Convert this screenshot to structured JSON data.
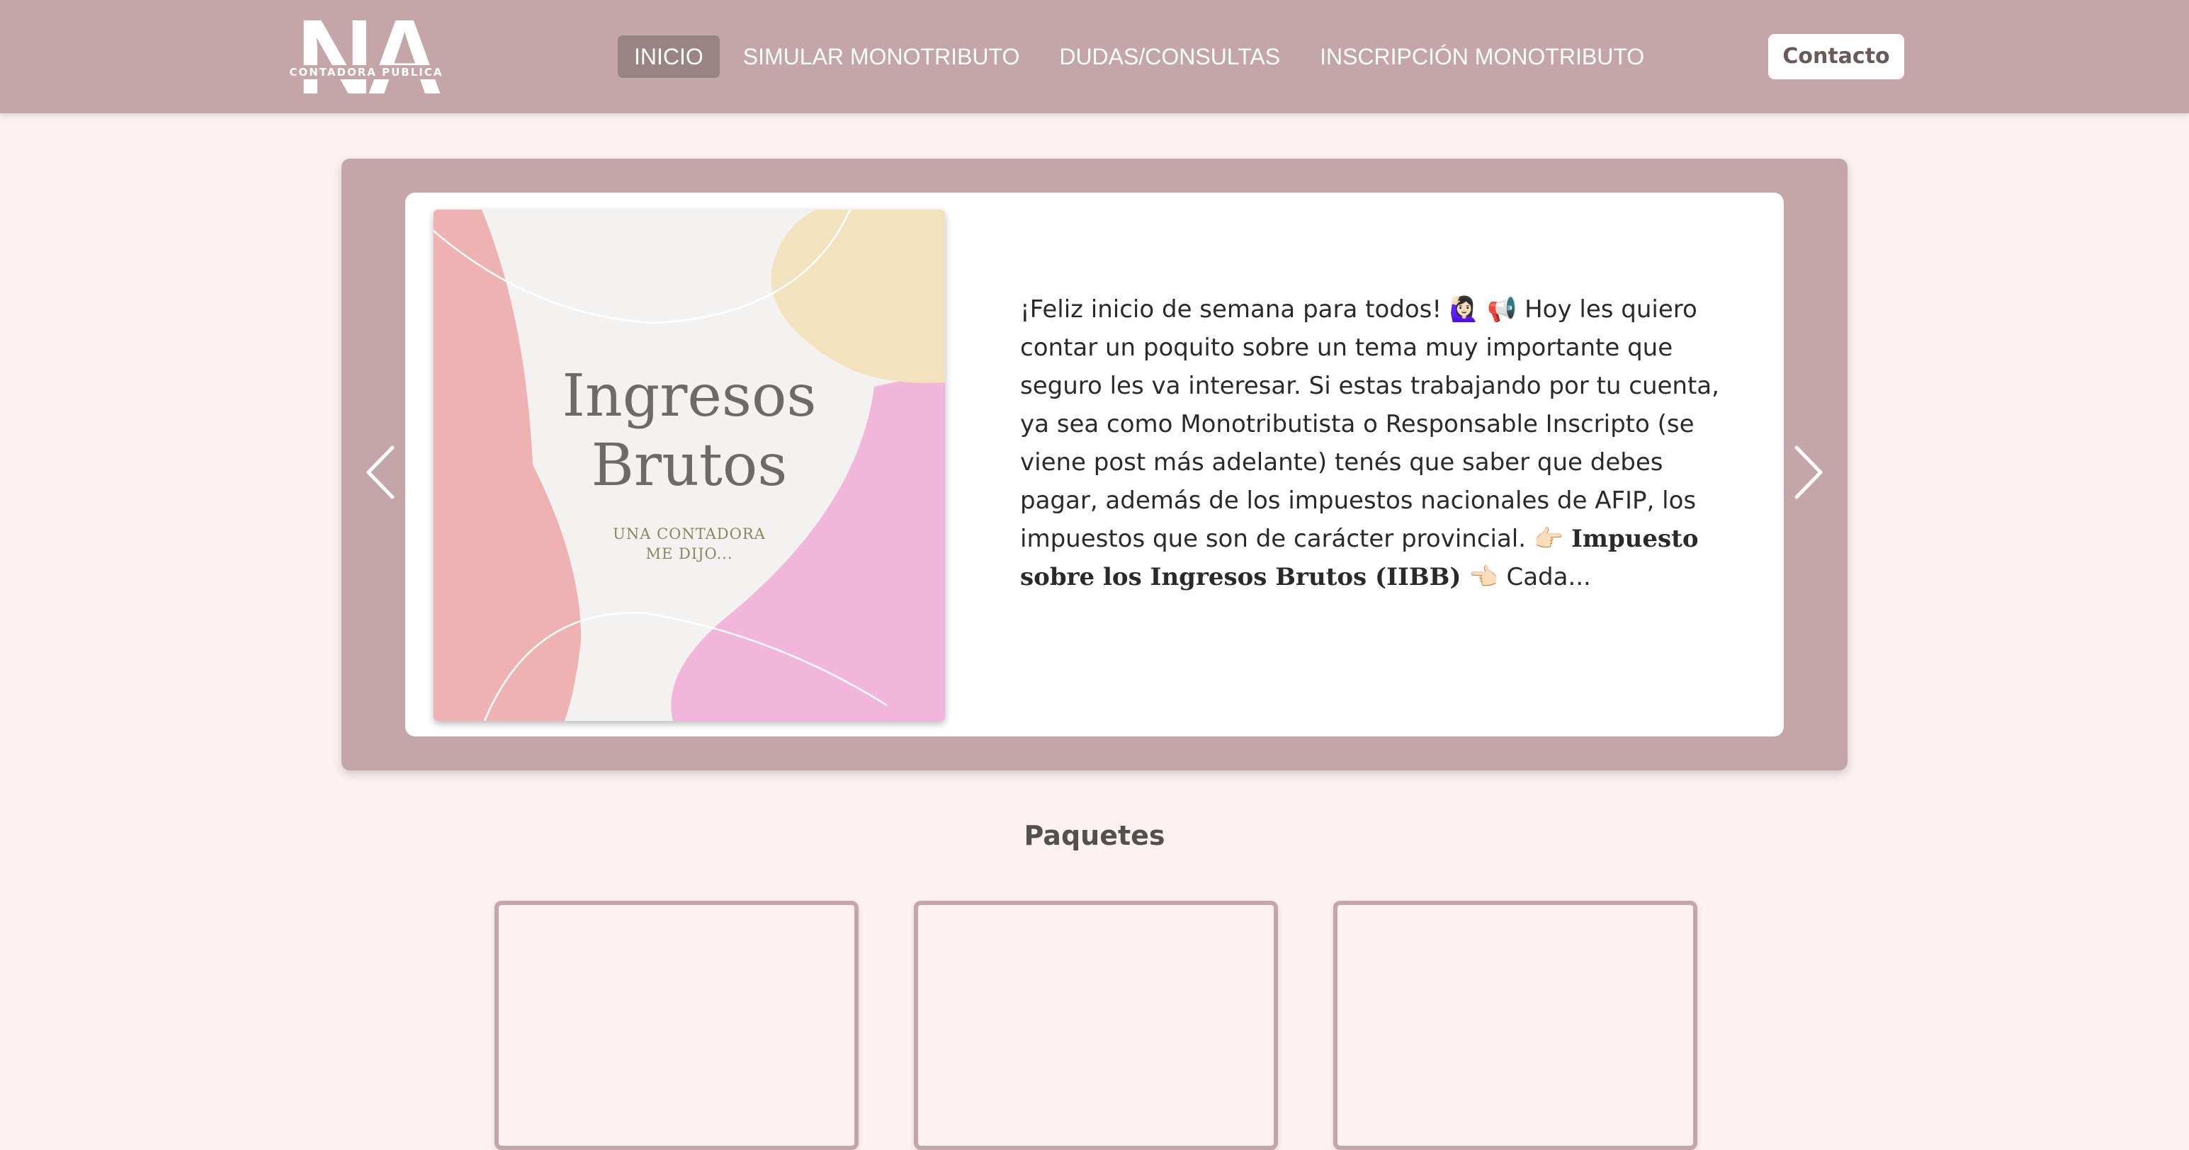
{
  "header": {
    "logo": {
      "letters": "NA",
      "subtitle": "CONTADORA PUBLICA"
    },
    "nav": [
      {
        "label": "INICIO",
        "active": true
      },
      {
        "label": "SIMULAR MONOTRIBUTO",
        "active": false
      },
      {
        "label": "DUDAS/CONSULTAS",
        "active": false
      },
      {
        "label": "INSCRIPCIÓN MONOTRIBUTO",
        "active": false
      }
    ],
    "contact_label": "Contacto"
  },
  "carousel": {
    "prev_icon": "chevron-left-icon",
    "next_icon": "chevron-right-icon",
    "slide": {
      "image": {
        "title_line1": "Ingresos",
        "title_line2": "Brutos",
        "subtitle_line1": "UNA CONTADORA",
        "subtitle_line2": "ME DIJO..."
      },
      "text": {
        "intro": "¡Feliz inicio de semana para todos!",
        "emoji1": "🙋🏻‍♀️",
        "emoji2": "📢",
        "body": " Hoy les quiero contar un poquito sobre un tema muy importante que seguro les va interesar. Si estas trabajando por tu cuenta, ya sea como Monotributista o Responsable Inscripto (se viene post más adelante) tenés que saber que debes pagar, además de los impuestos nacionales de AFIP, los impuestos que son de carácter provincial. ",
        "pointer_right": "👉🏻",
        "bold": "Impuesto sobre los Ingresos Brutos (IIBB)",
        "pointer_left": "👈🏻",
        "tail": " Cada..."
      }
    }
  },
  "packages": {
    "title": "Paquetes"
  },
  "colors": {
    "header_bg": "#c4a6a8",
    "active_nav_bg": "#9a8383",
    "page_bg": "#fdf1f1",
    "slide_bg": "#ffffff",
    "blob_pink": "#eeb2b2",
    "blob_magenta": "#f1b6da",
    "blob_yellow": "#f3e2be"
  }
}
